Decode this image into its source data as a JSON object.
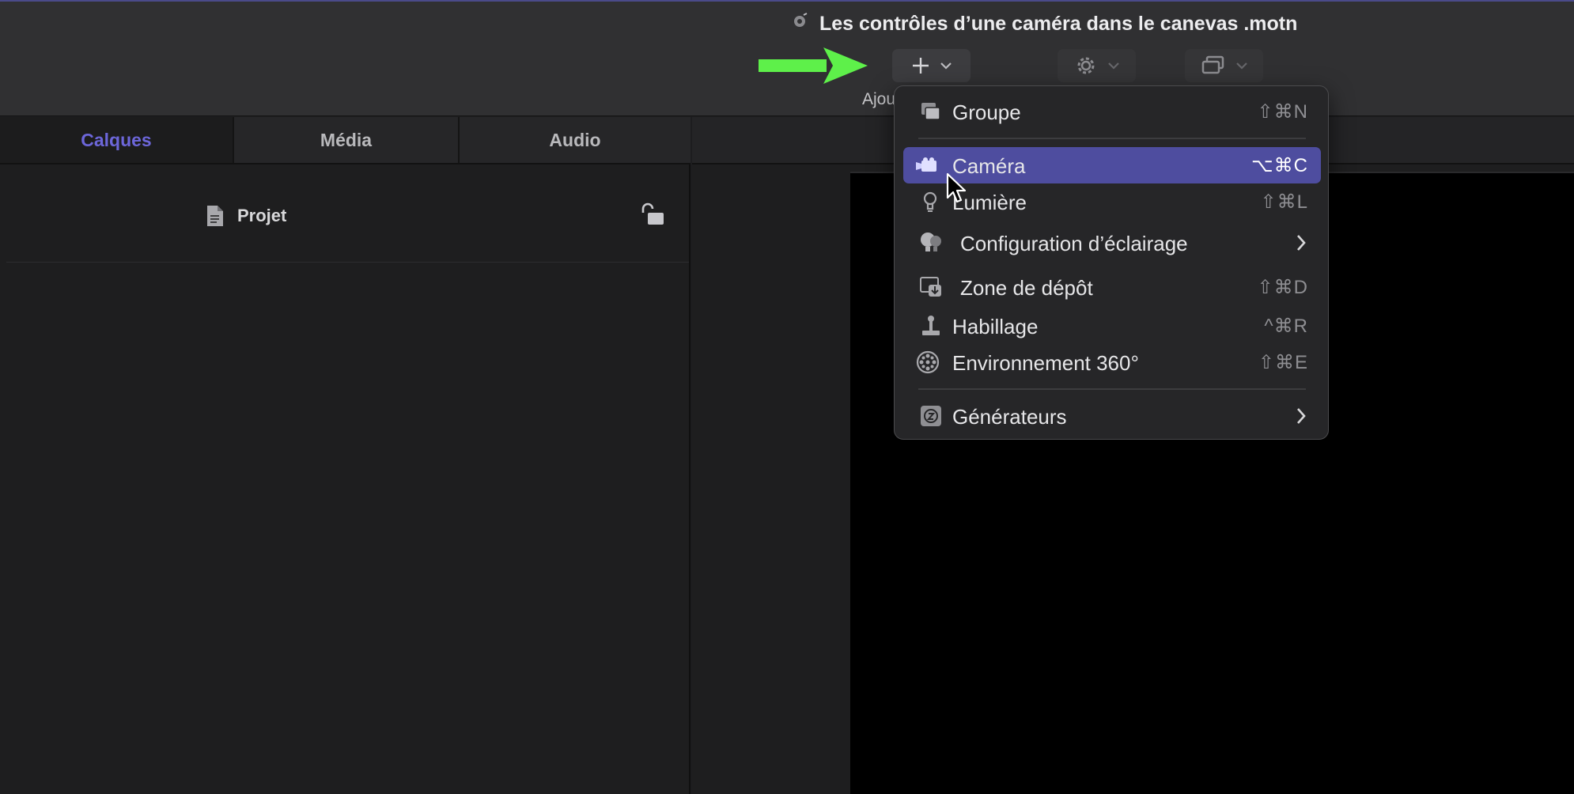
{
  "window": {
    "title": "Les contrôles d’une caméra dans le canevas .motn",
    "toolbar": {
      "add_label": "Ajouter",
      "add_icon": "plus-icon",
      "behaviors_icon": "gear-icon",
      "layout_icon": "windows-icon"
    }
  },
  "left_panel": {
    "tabs": [
      {
        "label": "Calques",
        "active": true
      },
      {
        "label": "Média",
        "active": false
      },
      {
        "label": "Audio",
        "active": false
      }
    ],
    "project_row": {
      "label": "Projet",
      "icon": "document-icon",
      "lock_icon": "unlocked-padlock-icon"
    }
  },
  "add_menu": {
    "items": [
      {
        "label": "Groupe",
        "shortcut": "⇧⌘N",
        "icon": "group-icon"
      },
      {
        "label": "Caméra",
        "shortcut": "⌥⌘C",
        "icon": "camera-icon",
        "highlighted": true
      },
      {
        "label": "Lumière",
        "shortcut": "⇧⌘L",
        "icon": "lightbulb-icon"
      },
      {
        "label": "Configuration d’éclairage",
        "submenu": true,
        "icon": "lighting-setup-icon"
      },
      {
        "label": "Zone de dépôt",
        "shortcut": "⇧⌘D",
        "icon": "drop-zone-icon"
      },
      {
        "label": "Habillage",
        "shortcut": "^⌘R",
        "icon": "rig-icon"
      },
      {
        "label": "Environnement 360°",
        "shortcut": "⇧⌘E",
        "icon": "environment-360-icon"
      },
      {
        "label": "Générateurs",
        "submenu": true,
        "icon": "generators-icon"
      }
    ]
  },
  "colors": {
    "accent": "#6c66d9",
    "highlight": "#4e4d9f",
    "arrow": "#5ef04a"
  }
}
